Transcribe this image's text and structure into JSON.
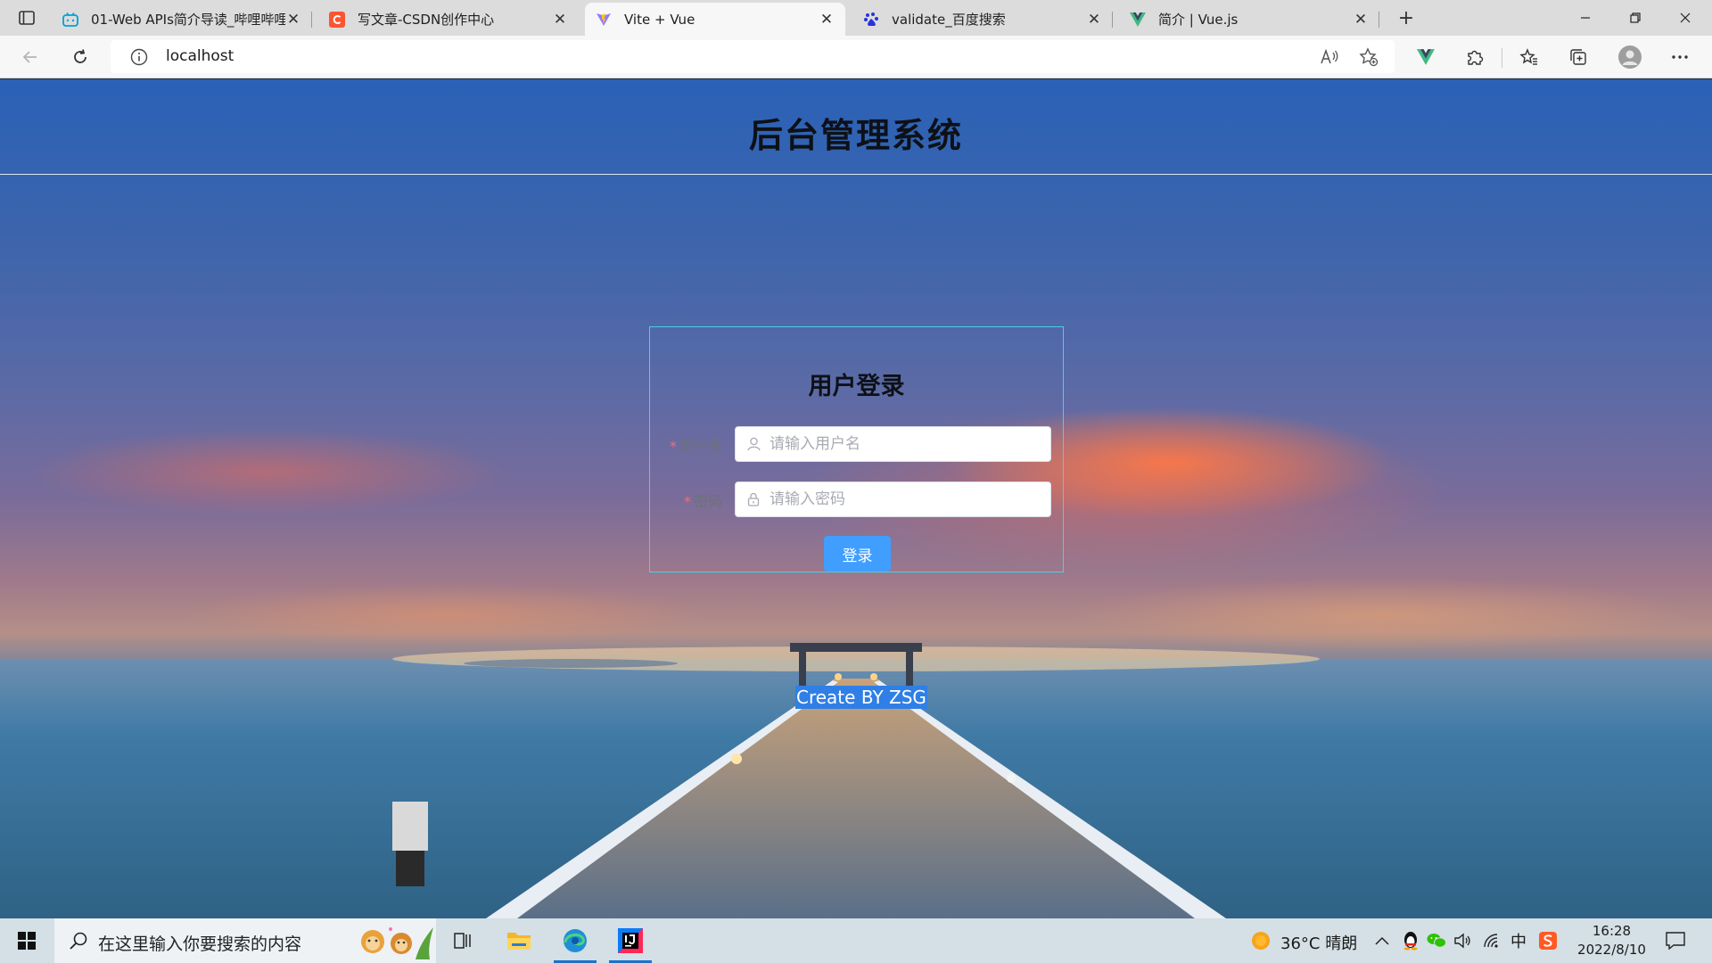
{
  "browser": {
    "tabs": [
      {
        "title": "01-Web APIs简介导读_哔哩哔哩",
        "favicon": "bilibili-icon",
        "active": false
      },
      {
        "title": "写文章-CSDN创作中心",
        "favicon": "csdn-icon",
        "active": false
      },
      {
        "title": "Vite + Vue",
        "favicon": "vite-icon",
        "active": true
      },
      {
        "title": "validate_百度搜索",
        "favicon": "baidu-icon",
        "active": false
      },
      {
        "title": "简介 | Vue.js",
        "favicon": "vue-icon",
        "active": false
      }
    ],
    "address": "localhost"
  },
  "page": {
    "title": "后台管理系统",
    "login": {
      "title": "用户登录",
      "username_label": "用户名",
      "username_placeholder": "请输入用户名",
      "password_label": "密码",
      "password_placeholder": "请输入密码",
      "submit_label": "登录",
      "required_mark": "*"
    },
    "footer": "Create BY ZSG"
  },
  "taskbar": {
    "search_placeholder": "在这里输入你要搜索的内容",
    "weather": "36°C 晴朗",
    "time": "16:28",
    "date": "2022/8/10",
    "ime": "中"
  },
  "colors": {
    "primary": "#409eff",
    "login_border": "#49d0e6",
    "required": "#f56c6c"
  }
}
